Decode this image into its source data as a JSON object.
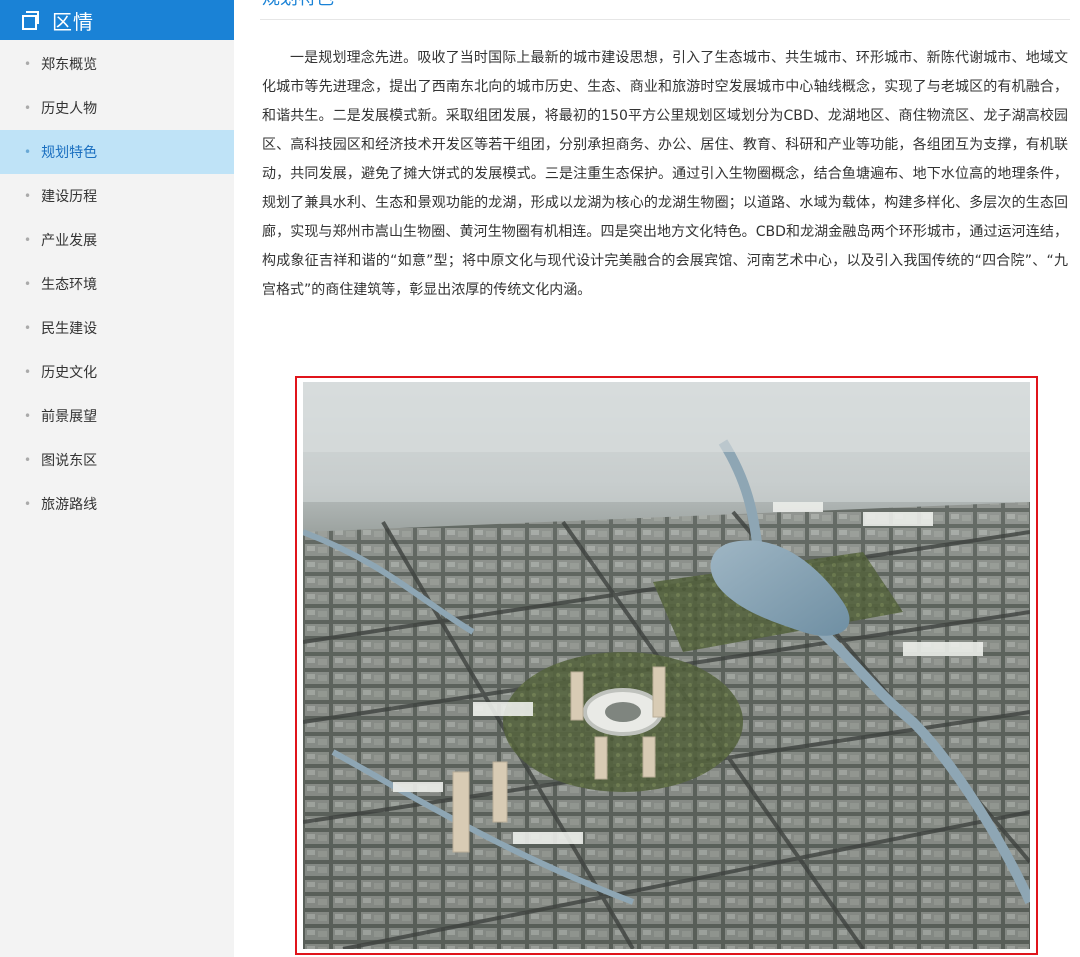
{
  "sidebar": {
    "title": "区情",
    "items": [
      {
        "label": "郑东概览",
        "active": false
      },
      {
        "label": "历史人物",
        "active": false
      },
      {
        "label": "规划特色",
        "active": true
      },
      {
        "label": "建设历程",
        "active": false
      },
      {
        "label": "产业发展",
        "active": false
      },
      {
        "label": "生态环境",
        "active": false
      },
      {
        "label": "民生建设",
        "active": false
      },
      {
        "label": "历史文化",
        "active": false
      },
      {
        "label": "前景展望",
        "active": false
      },
      {
        "label": "图说东区",
        "active": false
      },
      {
        "label": "旅游路线",
        "active": false
      }
    ]
  },
  "main": {
    "title": "规划特色",
    "paragraph": "一是规划理念先进。吸收了当时国际上最新的城市建设思想，引入了生态城市、共生城市、环形城市、新陈代谢城市、地域文化城市等先进理念，提出了西南东北向的城市历史、生态、商业和旅游时空发展城市中心轴线概念，实现了与老城区的有机融合，和谐共生。二是发展模式新。采取组团发展，将最初的150平方公里规划区域划分为CBD、龙湖地区、商住物流区、龙子湖高校园区、高科技园区和经济技术开发区等若干组团，分别承担商务、办公、居住、教育、科研和产业等功能，各组团互为支撑，有机联动，共同发展，避免了摊大饼式的发展模式。三是注重生态保护。通过引入生物圈概念，结合鱼塘遍布、地下水位高的地理条件，规划了兼具水利、生态和景观功能的龙湖，形成以龙湖为核心的龙湖生物圈；以道路、水域为载体，构建多样化、多层次的生态回廊，实现与郑州市嵩山生物圈、黄河生物圈有机相连。四是突出地方文化特色。CBD和龙湖金融岛两个环形城市，通过运河连结，构成象征吉祥和谐的“如意”型；将中原文化与现代设计完美融合的会展宾馆、河南艺术中心，以及引入我国传统的“四合院”、“九宫格式”的商住建筑等，彰显出浓厚的传统文化内涵。"
  },
  "colors": {
    "brand_blue": "#1a82d6",
    "active_bg": "#bfe3f7",
    "active_text": "#1a6fc0",
    "image_border": "#e0141b"
  }
}
